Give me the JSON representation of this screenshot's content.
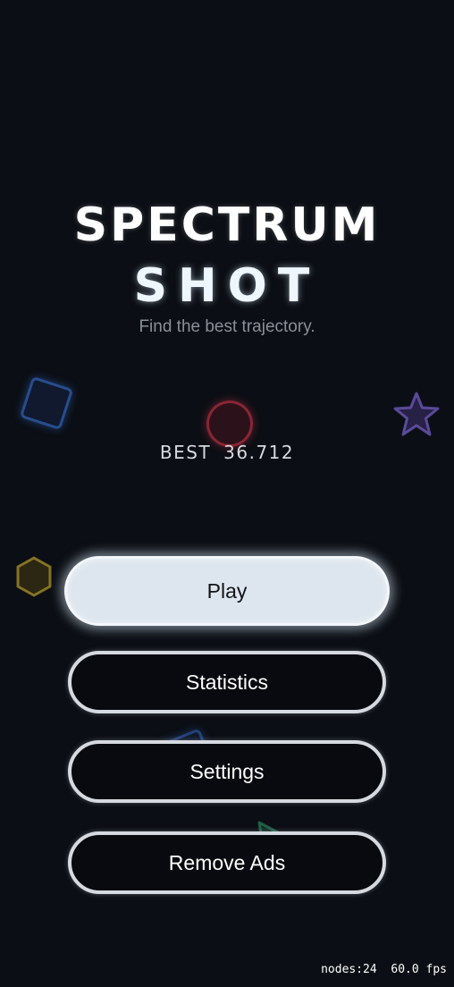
{
  "game": {
    "title_line_1": "SPECTRUM",
    "title_line_2": "SHOT",
    "subtitle": "Find the best trajectory.",
    "best_label": "BEST",
    "best_score": "36.712"
  },
  "menu": {
    "play_label": "Play",
    "statistics_label": "Statistics",
    "settings_label": "Settings",
    "remove_ads_label": "Remove Ads"
  },
  "debug": {
    "nodes": "nodes:24",
    "fps": "60.0 fps"
  },
  "decorations": [
    {
      "shape": "square",
      "color": "#3c78dc"
    },
    {
      "shape": "circle",
      "color": "#c83246"
    },
    {
      "shape": "star",
      "color": "#6a4fb0"
    },
    {
      "shape": "hexagon",
      "color": "#b8a030"
    },
    {
      "shape": "square",
      "color": "#3c78dc"
    },
    {
      "shape": "triangle",
      "color": "#2f8a6a"
    }
  ],
  "colors": {
    "background": "#0b0e14",
    "play_button_fill": "#dde5ee",
    "button_border": "#d6dae0",
    "subtitle_text": "#8a8f98"
  }
}
